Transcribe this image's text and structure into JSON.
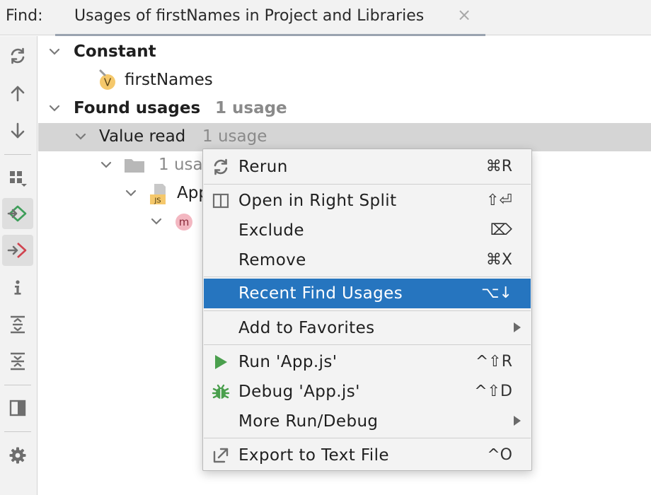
{
  "header": {
    "find_label": "Find:",
    "tab_title": "Usages of firstNames in Project and Libraries",
    "tab_close": "×"
  },
  "toolbar": {
    "buttons": [
      {
        "name": "rerun",
        "icon": "refresh-icon"
      },
      {
        "name": "previous-occurrence",
        "icon": "arrow-up-icon"
      },
      {
        "name": "next-occurrence",
        "icon": "arrow-down-icon"
      },
      {
        "name": "group-by",
        "icon": "group-by-icon"
      },
      {
        "name": "show-read-access",
        "icon": "read-access-icon",
        "active": true
      },
      {
        "name": "show-write-access",
        "icon": "write-access-icon",
        "active": true
      },
      {
        "name": "info",
        "icon": "info-icon"
      },
      {
        "name": "expand-all",
        "icon": "expand-all-icon"
      },
      {
        "name": "collapse-all",
        "icon": "collapse-all-icon"
      },
      {
        "name": "preview",
        "icon": "preview-panel-icon"
      },
      {
        "name": "settings",
        "icon": "gear-icon"
      }
    ]
  },
  "tree": {
    "constant_label": "Constant",
    "variable_badge": "V",
    "variable_name": "firstNames",
    "found_usages_label": "Found usages",
    "found_usages_count": "1 usage",
    "value_read_label": "Value read",
    "value_read_count": "1 usage",
    "folder_count": "1 usa",
    "file_name": "App",
    "file_badge": "JS",
    "method_badge": "m"
  },
  "menu": {
    "items": [
      {
        "label": "Rerun",
        "shortcut": "⌘R",
        "icon": "refresh-icon"
      },
      {
        "label": "Open in Right Split",
        "shortcut": "⇧⏎",
        "icon": "split-icon"
      },
      {
        "label": "Exclude",
        "shortcut": "⌦",
        "icon": ""
      },
      {
        "label": "Remove",
        "shortcut": "⌘X",
        "icon": ""
      },
      {
        "label": "Recent Find Usages",
        "shortcut": "⌥↓",
        "icon": "",
        "highlighted": true
      },
      {
        "label": "Add to Favorites",
        "shortcut": "",
        "icon": "",
        "submenu": true
      },
      {
        "label": "Run 'App.js'",
        "shortcut": "^⇧R",
        "icon": "run-icon"
      },
      {
        "label": "Debug 'App.js'",
        "shortcut": "^⇧D",
        "icon": "debug-icon"
      },
      {
        "label": "More Run/Debug",
        "shortcut": "",
        "icon": "",
        "submenu": true
      },
      {
        "label": "Export to Text File",
        "shortcut": "^O",
        "icon": "export-icon"
      }
    ]
  },
  "colors": {
    "highlight": "#2675bf",
    "run_green": "#4a9f4d",
    "read_access_green": "#3e9e5a",
    "write_access_red": "#d0434f",
    "variable_badge_bg": "#f5c86b",
    "method_badge_bg": "#f3b7c1"
  }
}
